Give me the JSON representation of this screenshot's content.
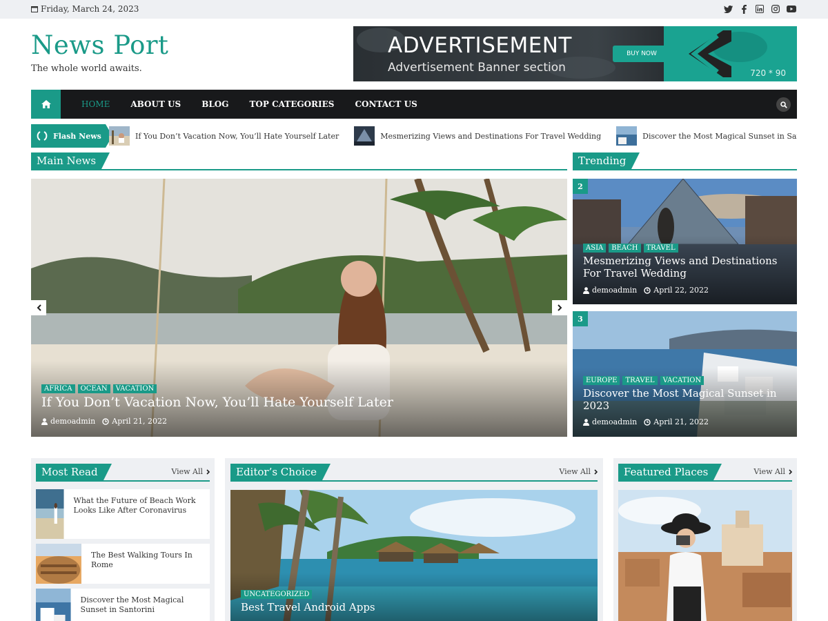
{
  "topbar": {
    "date": "Friday, March 24, 2023",
    "social": [
      "twitter-icon",
      "facebook-icon",
      "linkedin-icon",
      "instagram-icon",
      "youtube-icon"
    ]
  },
  "header": {
    "logo": "News Port",
    "tagline": "The whole world awaits."
  },
  "ad": {
    "title": "ADVERTISEMENT",
    "subtitle": "Advertisement Banner section",
    "button": "BUY NOW",
    "size": "720 * 90"
  },
  "nav": {
    "items": [
      "HOME",
      "ABOUT US",
      "BLOG",
      "TOP CATEGORIES",
      "CONTACT US"
    ],
    "active": "HOME"
  },
  "flash": {
    "label": "Flash News",
    "items": [
      "If You Don’t Vacation Now, You’ll Hate Yourself Later",
      "Mesmerizing Views and Destinations For Travel Wedding",
      "Discover the Most Magical Sunset in Santorini"
    ]
  },
  "main_news": {
    "heading": "Main News",
    "slide": {
      "categories": [
        "AFRICA",
        "OCEAN",
        "VACATION"
      ],
      "title": "If You Don’t Vacation Now, You’ll Hate Yourself Later",
      "author": "demoadmin",
      "date": "April 21, 2022"
    }
  },
  "trending": {
    "heading": "Trending",
    "items": [
      {
        "num": "2",
        "categories": [
          "ASIA",
          "BEACH",
          "TRAVEL"
        ],
        "title": "Mesmerizing Views and Destinations For Travel Wedding",
        "author": "demoadmin",
        "date": "April 22, 2022"
      },
      {
        "num": "3",
        "categories": [
          "EUROPE",
          "TRAVEL",
          "VACATION"
        ],
        "title": "Discover the Most Magical Sunset in 2023",
        "author": "demoadmin",
        "date": "April 21, 2022"
      }
    ]
  },
  "most_read": {
    "heading": "Most Read",
    "view_all": "View All",
    "items": [
      "What the Future of Beach Work Looks Like After Coronavirus",
      "The Best Walking Tours In Rome",
      "Discover the Most Magical Sunset in Santorini"
    ]
  },
  "editors_choice": {
    "heading": "Editor’s Choice",
    "view_all": "View All",
    "category": "UNCATEGORIZED",
    "title": "Best Travel Android Apps"
  },
  "featured": {
    "heading": "Featured Places",
    "view_all": "View All"
  },
  "colors": {
    "accent": "#1a9a88",
    "nav_bg": "#18191b",
    "topbar_bg": "#eef0f3"
  }
}
